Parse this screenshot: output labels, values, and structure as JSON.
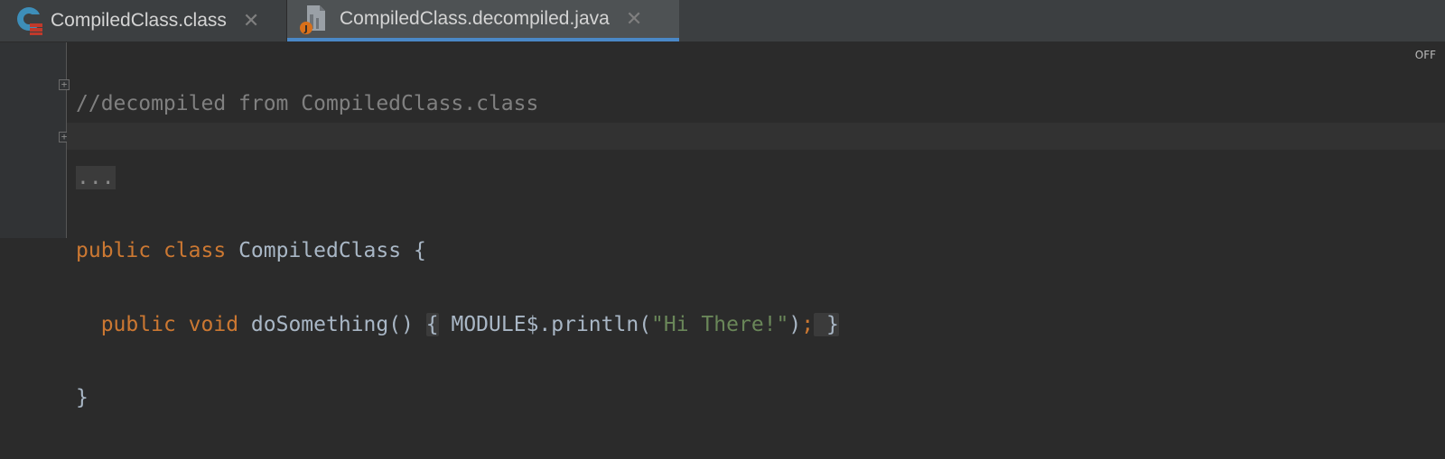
{
  "tabs": [
    {
      "label": "CompiledClass.class",
      "icon": "scala-class-icon",
      "active": false
    },
    {
      "label": "CompiledClass.decompiled.java",
      "icon": "java-file-icon",
      "active": true
    }
  ],
  "close_glyph": "✕",
  "editor": {
    "status_off": "OFF",
    "lines": {
      "comment": "//decompiled from CompiledClass.class",
      "ellipsis": "...",
      "kw_public": "public",
      "kw_class": "class",
      "class_name": "CompiledClass",
      "open_brace": "{",
      "kw_public2": "public",
      "kw_void": "void",
      "method_sig": "doSomething()",
      "fold_open": "{",
      "call": " MODULE$.println(",
      "string": "\"Hi There!\"",
      "call_end": ")",
      "semicolon": ";",
      "fold_close": "}",
      "close_brace": "}"
    }
  },
  "colors": {
    "background": "#2b2b2b",
    "keyword": "#cc7832",
    "string": "#6a8759",
    "comment": "#808080",
    "text": "#a9b7c6",
    "tab_underline": "#4a88c7"
  }
}
